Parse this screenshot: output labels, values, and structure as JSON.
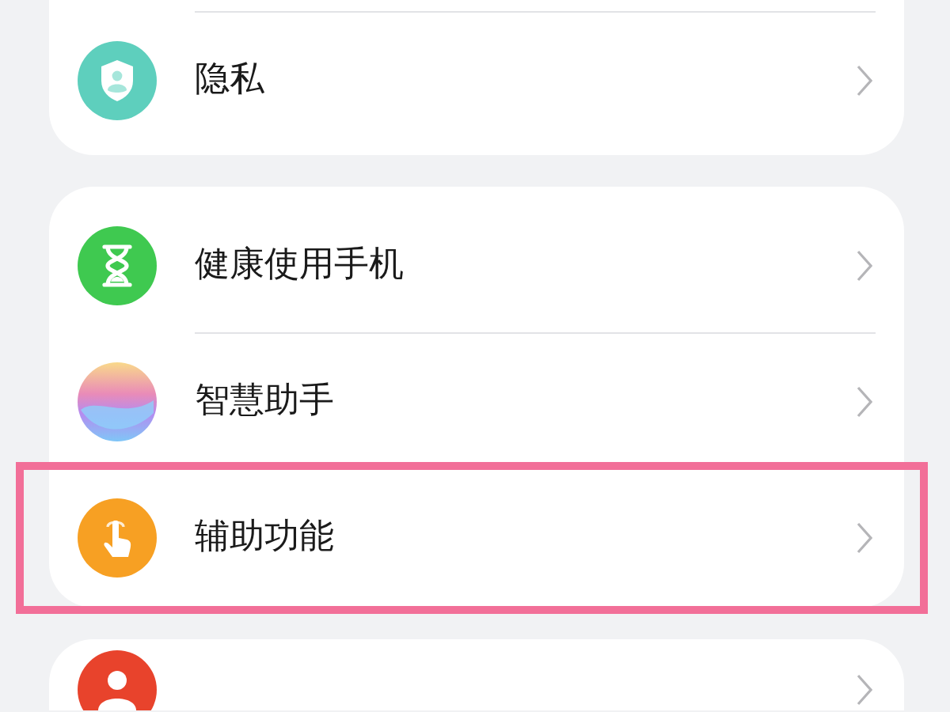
{
  "groups": [
    {
      "items": [
        {
          "kind": "shield",
          "label": "隐私",
          "highlighted": false
        }
      ]
    },
    {
      "items": [
        {
          "kind": "hourglass",
          "label": "健康使用手机",
          "highlighted": false
        },
        {
          "kind": "orb",
          "label": "智慧助手",
          "highlighted": false
        },
        {
          "kind": "hand",
          "label": "辅助功能",
          "highlighted": true
        }
      ]
    },
    {
      "items": [
        {
          "kind": "person",
          "highlighted": false
        }
      ]
    }
  ]
}
